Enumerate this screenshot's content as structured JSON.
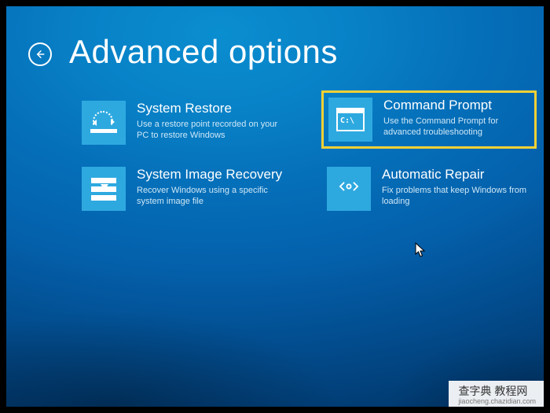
{
  "header": {
    "title": "Advanced options"
  },
  "options": [
    {
      "title": "System Restore",
      "desc": "Use a restore point recorded on your PC to restore Windows",
      "icon": "restore-icon",
      "highlighted": false
    },
    {
      "title": "Command Prompt",
      "desc": "Use the Command Prompt for advanced troubleshooting",
      "icon": "cmd-icon",
      "highlighted": true
    },
    {
      "title": "System Image Recovery",
      "desc": "Recover Windows using a specific system image file",
      "icon": "recover-icon",
      "highlighted": false
    },
    {
      "title": "Automatic Repair",
      "desc": "Fix problems that keep Windows from loading",
      "icon": "repair-icon",
      "highlighted": false
    }
  ],
  "cmd_glyph": "C:\\",
  "watermark": {
    "main": "查字典 教程网",
    "sub": "jiaocheng.chazidian.com"
  },
  "colors": {
    "tile": "#2ea9e0",
    "highlight": "#f5d135"
  }
}
